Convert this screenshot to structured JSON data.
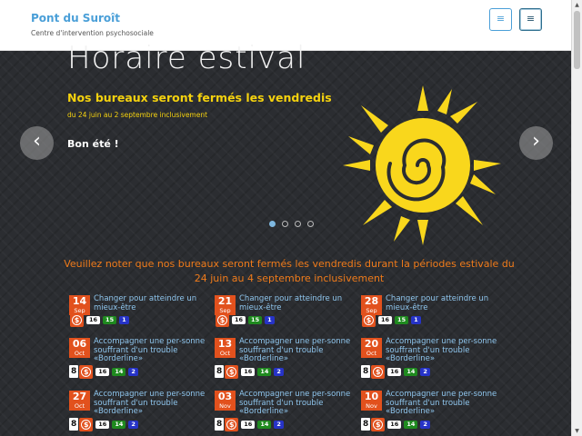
{
  "header": {
    "site_title": "Pont du Suroît",
    "site_subtitle": "Centre d'intervention psychosociale",
    "menu_icon_1": "≡",
    "menu_icon_2": "≡"
  },
  "slider": {
    "title": "Horaire estival",
    "subtitle": "Nos bureaux seront fermés les vendredis",
    "date_text": "du 24 juin au 2 septembre inclusivement",
    "body_text": "Bon été !",
    "prev_icon": "‹",
    "next_icon": "›",
    "dots": 4,
    "active_dot": 1,
    "colors": {
      "accent": "#f5d20e",
      "sun": "#f9d71c"
    }
  },
  "notice": {
    "text": "Veuillez noter que nos bureaux seront fermés les vendredis durant la périodes estivale du 24 juin au 4 septembre inclusivement"
  },
  "events": [
    {
      "day": "14",
      "month": "Sep",
      "title": "Changer pour atteindre un mieux-être",
      "badge_num": "",
      "age": "16",
      "green": "15",
      "blue": "1"
    },
    {
      "day": "21",
      "month": "Sep",
      "title": "Changer pour atteindre un mieux-être",
      "badge_num": "",
      "age": "16",
      "green": "15",
      "blue": "1"
    },
    {
      "day": "28",
      "month": "Sep",
      "title": "Changer pour atteindre un mieux-être",
      "badge_num": "",
      "age": "16",
      "green": "15",
      "blue": "1"
    },
    {
      "day": "06",
      "month": "Oct",
      "title": "Accompagner une per-sonne souffrant d'un trouble «Borderline»",
      "badge_num": "8",
      "age": "16",
      "green": "14",
      "blue": "2"
    },
    {
      "day": "13",
      "month": "Oct",
      "title": "Accompagner une per-sonne souffrant d'un trouble «Borderline»",
      "badge_num": "8",
      "age": "16",
      "green": "14",
      "blue": "2"
    },
    {
      "day": "20",
      "month": "Oct",
      "title": "Accompagner une per-sonne souffrant d'un trouble «Borderline»",
      "badge_num": "8",
      "age": "16",
      "green": "14",
      "blue": "2"
    },
    {
      "day": "27",
      "month": "Oct",
      "title": "Accompagner une per-sonne souffrant d'un trouble «Borderline»",
      "badge_num": "8",
      "age": "16",
      "green": "14",
      "blue": "2"
    },
    {
      "day": "03",
      "month": "Nov",
      "title": "Accompagner une per-sonne souffrant d'un trouble «Borderline»",
      "badge_num": "8",
      "age": "16",
      "green": "14",
      "blue": "2"
    },
    {
      "day": "10",
      "month": "Nov",
      "title": "Accompagner une per-sonne souffrant d'un trouble «Borderline»",
      "badge_num": "8",
      "age": "16",
      "green": "14",
      "blue": "2"
    }
  ]
}
